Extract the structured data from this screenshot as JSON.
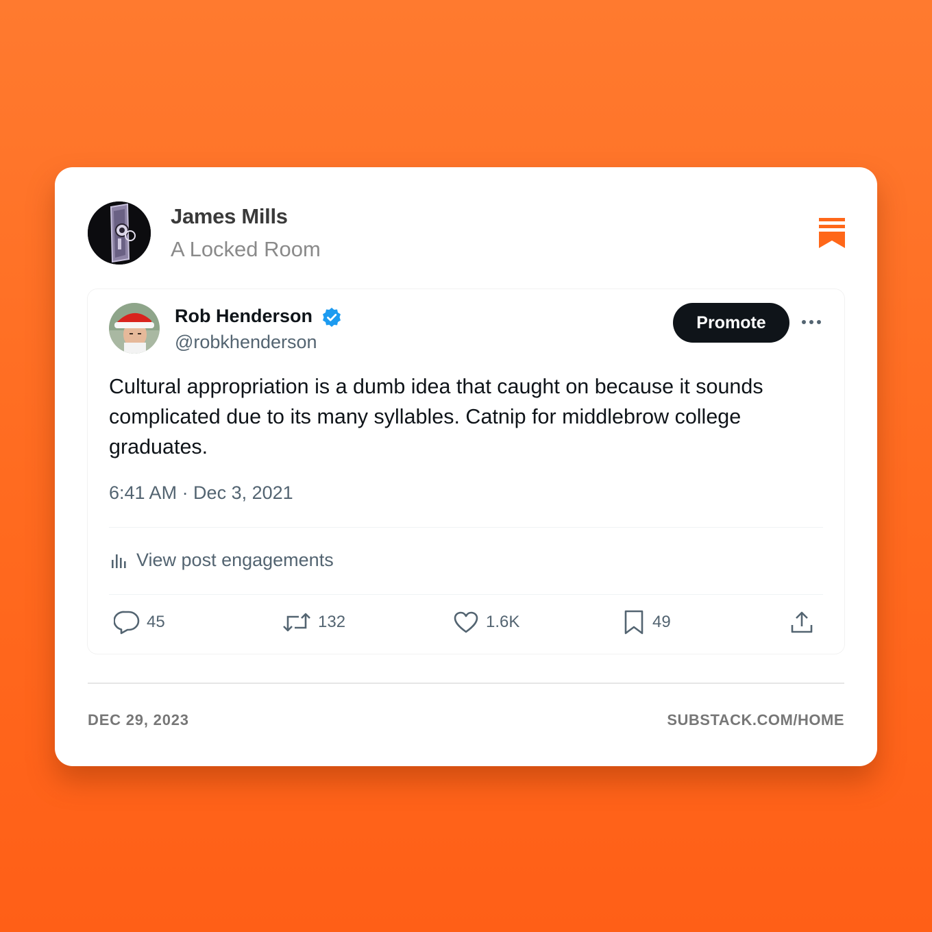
{
  "post": {
    "author_name": "James Mills",
    "publication": "A Locked Room",
    "date": "DEC 29, 2023",
    "site": "SUBSTACK.COM/HOME",
    "brand_color": "#ff6719"
  },
  "tweet": {
    "name": "Rob Henderson",
    "handle": "@robkhenderson",
    "verified": true,
    "promote_label": "Promote",
    "text": "Cultural appropriation is a dumb idea that caught on because it sounds complicated due to its many syllables. Catnip for middlebrow college graduates.",
    "timestamp": "6:41 AM · Dec 3, 2021",
    "engagements_label": "View post engagements",
    "replies": "45",
    "reposts": "132",
    "likes": "1.6K",
    "bookmarks": "49"
  },
  "icons": {
    "verified": "verified-badge-icon",
    "more": "more-horizontal-icon",
    "engagements": "analytics-bars-icon",
    "reply": "speech-bubble-icon",
    "repost": "repost-arrows-icon",
    "like": "heart-icon",
    "bookmark": "bookmark-icon",
    "share": "share-upload-icon",
    "brand": "substack-logo-icon"
  }
}
